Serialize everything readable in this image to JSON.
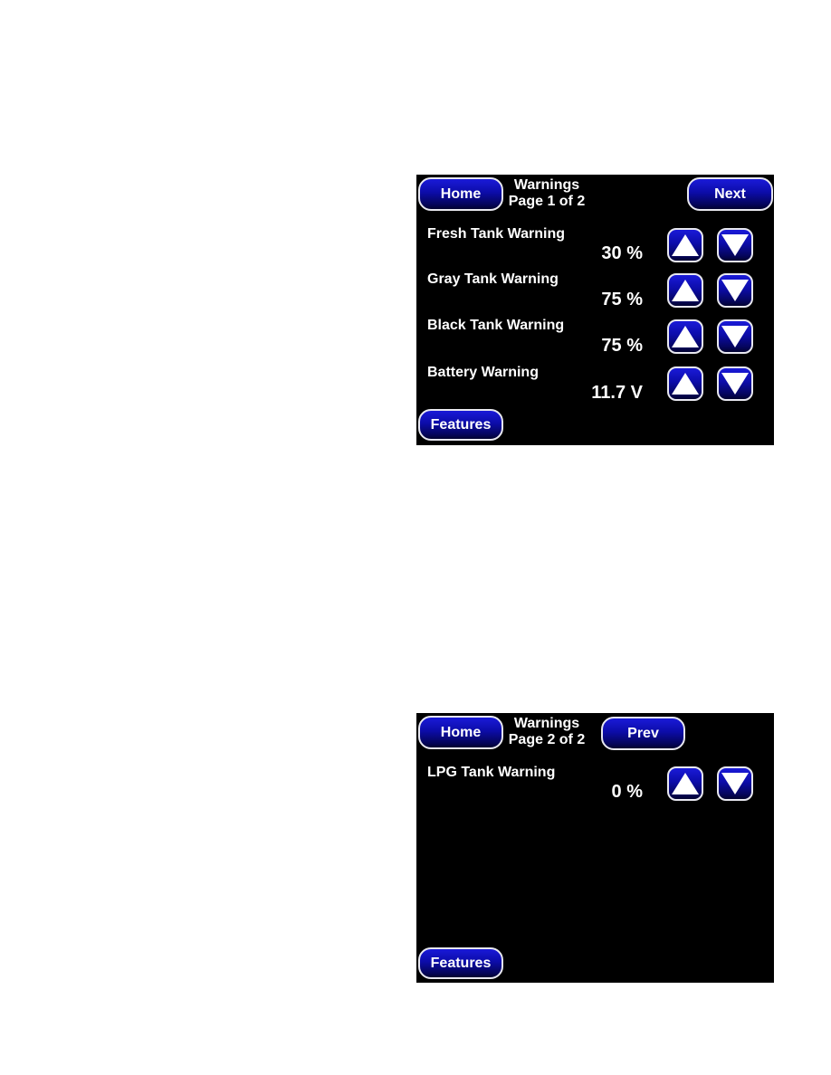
{
  "screens": [
    {
      "title_line1": "Warnings",
      "title_line2": "Page 1 of 2",
      "home_label": "Home",
      "nav_label": "Next",
      "features_label": "Features",
      "rows": [
        {
          "label": "Fresh Tank Warning",
          "value": "30 %"
        },
        {
          "label": "Gray Tank Warning",
          "value": "75 %"
        },
        {
          "label": "Black Tank Warning",
          "value": "75 %"
        },
        {
          "label": "Battery Warning",
          "value": "11.7 V"
        }
      ]
    },
    {
      "title_line1": "Warnings",
      "title_line2": "Page 2 of 2",
      "home_label": "Home",
      "nav_label": "Prev",
      "features_label": "Features",
      "rows": [
        {
          "label": "LPG Tank Warning",
          "value": "0 %"
        }
      ]
    }
  ],
  "icons": {
    "increase": "up-arrow-icon",
    "decrease": "down-arrow-icon"
  },
  "colors": {
    "screen_background": "#000000",
    "button_top": "#1a1ad8",
    "button_bottom": "#020230",
    "button_border": "#e8e8f0",
    "text": "#ffffff"
  }
}
